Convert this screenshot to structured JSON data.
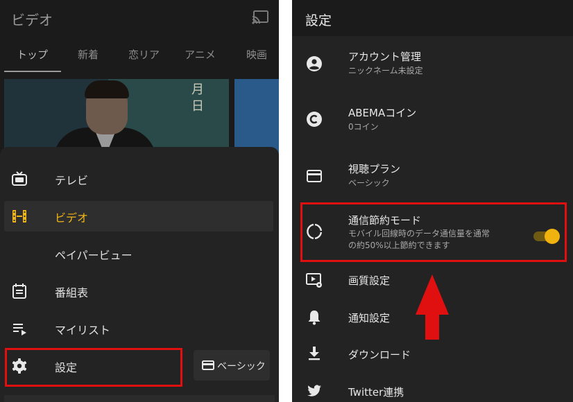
{
  "left": {
    "title": "ビデオ",
    "tabs": [
      "トップ",
      "新着",
      "恋リア",
      "アニメ",
      "映画"
    ],
    "thumbnail_text": "月 日",
    "menu": [
      {
        "label": "テレビ",
        "icon": "tv-icon",
        "active": false
      },
      {
        "label": "ビデオ",
        "icon": "film-icon",
        "active": true
      },
      {
        "label": "ペイパービュー",
        "icon": "",
        "active": false
      },
      {
        "label": "番組表",
        "icon": "calendar-icon",
        "active": false
      },
      {
        "label": "マイリスト",
        "icon": "playlist-icon",
        "active": false
      },
      {
        "label": "設定",
        "icon": "gear-icon",
        "active": false
      }
    ],
    "plan_button": "ベーシック"
  },
  "right": {
    "title": "設定",
    "items": [
      {
        "title": "アカウント管理",
        "subtitle": "ニックネーム未設定",
        "icon": "account-icon"
      },
      {
        "title": "ABEMAコイン",
        "subtitle": "0コイン",
        "icon": "coin-icon"
      },
      {
        "title": "視聴プラン",
        "subtitle": "ベーシック",
        "icon": "card-icon"
      },
      {
        "title": "通信節約モード",
        "subtitle_line1": "モバイル回線時のデータ通信量を通常",
        "subtitle_line2": "の約50%以上節約できます",
        "icon": "data-saver-icon",
        "toggle_on": true
      },
      {
        "title": "画質設定",
        "icon": "video-settings-icon"
      },
      {
        "title": "通知設定",
        "icon": "bell-icon"
      },
      {
        "title": "ダウンロード",
        "icon": "download-icon"
      },
      {
        "title": "Twitter連携",
        "icon": "twitter-icon"
      }
    ]
  },
  "colors": {
    "accent": "#f3b617",
    "highlight_border": "#e01010",
    "arrow": "#e01010",
    "panel_bg": "#232323",
    "header_bg": "#1b1b1b"
  }
}
